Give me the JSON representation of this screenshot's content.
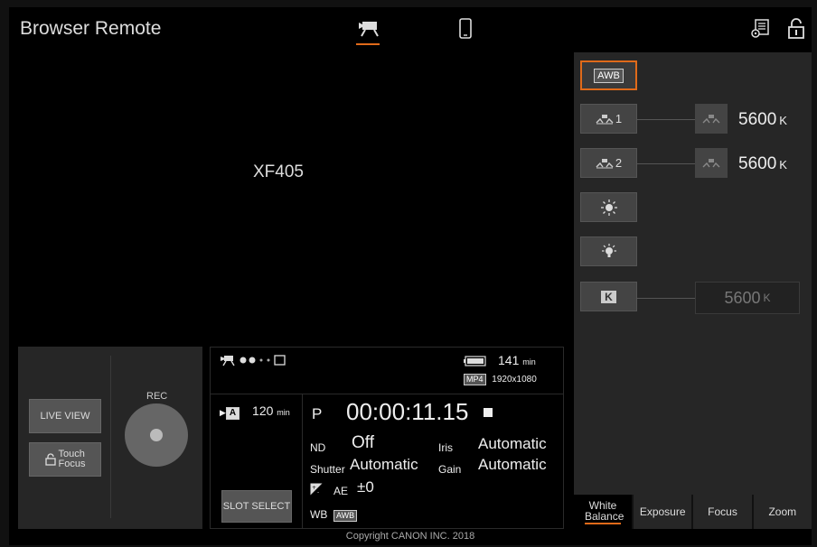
{
  "header": {
    "title": "Browser Remote",
    "modes": [
      {
        "name": "camera-mode",
        "icon": "video-camera-icon",
        "active": true
      },
      {
        "name": "phone-mode",
        "icon": "smartphone-icon",
        "active": false
      }
    ],
    "right_icons": [
      "remote-settings-icon",
      "lock-icon"
    ]
  },
  "camera_name": "XF405",
  "white_balance": {
    "awb_label": "AWB",
    "set1_label": "1",
    "set2_label": "2",
    "set1_temp": "5600",
    "set2_temp": "5600",
    "kelvin_label": "K",
    "kelvin_value": "5600",
    "unit": "K"
  },
  "tabs": {
    "white_balance": "White Balance",
    "exposure": "Exposure",
    "focus": "Focus",
    "zoom": "Zoom"
  },
  "rec_panel": {
    "live_view": "LIVE VIEW",
    "touch_focus_1": "Touch",
    "touch_focus_2": "Focus",
    "rec_label": "REC"
  },
  "status": {
    "remaining_time": "141",
    "remaining_unit": "min",
    "format": "MP4",
    "resolution": "1920x1080",
    "slot": "A",
    "slot_time": "120",
    "slot_unit": "min",
    "mode": "P",
    "timecode": "00:00:11.15",
    "nd_label": "ND",
    "nd_value": "Off",
    "iris_label": "Iris",
    "iris_value": "Automatic",
    "shutter_label": "Shutter",
    "shutter_value": "Automatic",
    "gain_label": "Gain",
    "gain_value": "Automatic",
    "ae_label": "AE",
    "ae_value": "±0",
    "wb_label": "WB",
    "wb_value": "AWB",
    "slot_select": "SLOT SELECT"
  },
  "copyright": "Copyright CANON INC. 2018",
  "colors": {
    "accent": "#e06a1a",
    "panel": "#262626",
    "background": "#000000"
  }
}
